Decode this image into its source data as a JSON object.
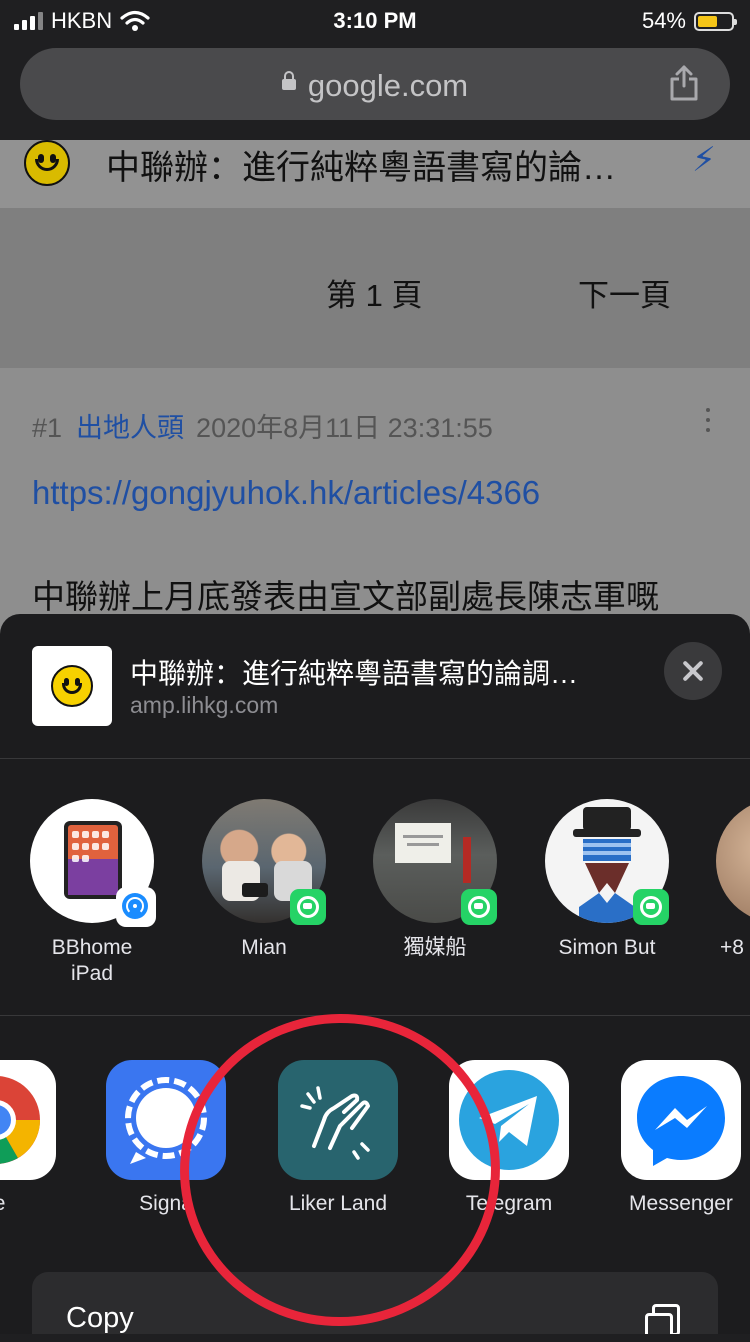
{
  "status_bar": {
    "carrier": "HKBN",
    "time": "3:10 PM",
    "battery_percent": "54%",
    "signal_icon": "signal-bars-icon",
    "wifi_icon": "wifi-icon"
  },
  "browser": {
    "url": "google.com",
    "share_icon": "share-icon"
  },
  "webpage": {
    "title": "中聯辦：進行純粹粵語書寫的論…",
    "pager_current": "第 1 頁",
    "pager_next": "下一頁",
    "post": {
      "number": "#1",
      "author": "出地人頭",
      "timestamp": "2020年8月11日 23:31:55",
      "link": "https://gongjyuhok.hk/articles/4366",
      "text": "中聯辦上月底發表由宣文部副處長陳志軍嘅"
    }
  },
  "share_sheet": {
    "title": "中聯辦：進行純粹粵語書寫的論調…",
    "url": "amp.lihkg.com",
    "people": [
      {
        "label": "BBhome iPad",
        "badge": "airdrop-icon"
      },
      {
        "label": "Mian",
        "badge": "whatsapp-icon"
      },
      {
        "label": "獨媒船",
        "badge": "whatsapp-icon"
      },
      {
        "label": "Simon But",
        "badge": "whatsapp-icon"
      },
      {
        "label": "+8",
        "badge": ""
      }
    ],
    "apps": [
      {
        "label": "ome",
        "icon": "chrome-icon"
      },
      {
        "label": "Signa",
        "icon": "signal-icon"
      },
      {
        "label": "Liker Land",
        "icon": "liker-land-icon"
      },
      {
        "label": "Telegram",
        "icon": "telegram-icon"
      },
      {
        "label": "Messenger",
        "icon": "messenger-icon"
      }
    ],
    "action": "Copy"
  },
  "colors": {
    "highlight_circle": "#e8253a",
    "sheet_background": "#1c1c1e",
    "link_blue": "#1f4fa3",
    "whatsapp_green": "#25d366"
  }
}
